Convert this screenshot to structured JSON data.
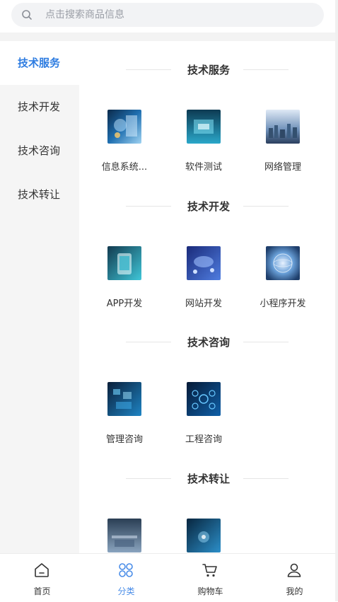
{
  "search": {
    "placeholder": "点击搜索商品信息",
    "icon": "search-icon"
  },
  "sidebar": {
    "items": [
      {
        "label": "技术服务",
        "active": true
      },
      {
        "label": "技术开发",
        "active": false
      },
      {
        "label": "技术咨询",
        "active": false
      },
      {
        "label": "技术转让",
        "active": false
      }
    ]
  },
  "content": {
    "sections": [
      {
        "title": "技术服务",
        "items": [
          {
            "label": "信息系统..."
          },
          {
            "label": "软件测试"
          },
          {
            "label": "网络管理"
          }
        ]
      },
      {
        "title": "技术开发",
        "items": [
          {
            "label": "APP开发"
          },
          {
            "label": "网站开发"
          },
          {
            "label": "小程序开发"
          }
        ]
      },
      {
        "title": "技术咨询",
        "items": [
          {
            "label": "管理咨询"
          },
          {
            "label": "工程咨询"
          }
        ]
      },
      {
        "title": "技术转让",
        "items": [
          {
            "label": ""
          },
          {
            "label": ""
          }
        ]
      }
    ]
  },
  "tabbar": {
    "items": [
      {
        "label": "首页",
        "icon": "home-icon"
      },
      {
        "label": "分类",
        "icon": "category-icon",
        "active": true
      },
      {
        "label": "购物车",
        "icon": "cart-icon"
      },
      {
        "label": "我的",
        "icon": "user-icon"
      }
    ]
  },
  "colors": {
    "accent": "#2f7de1",
    "tab_active": "#4a8de8",
    "sidebar_bg": "#f5f5f5",
    "text": "#333333"
  }
}
